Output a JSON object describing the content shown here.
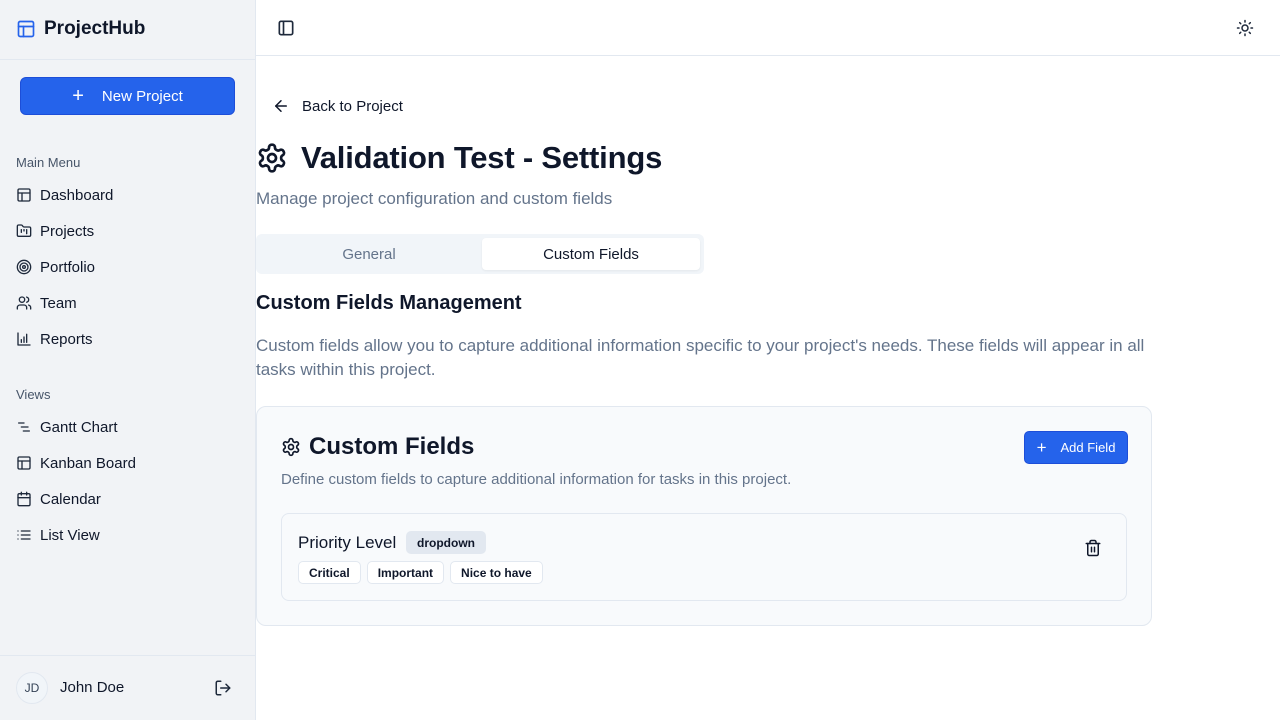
{
  "app": {
    "name": "ProjectHub"
  },
  "sidebar": {
    "new_project_label": "New Project",
    "main_menu_label": "Main Menu",
    "main_menu": [
      {
        "label": "Dashboard",
        "icon": "layout-icon"
      },
      {
        "label": "Projects",
        "icon": "folder-kanban-icon"
      },
      {
        "label": "Portfolio",
        "icon": "target-icon"
      },
      {
        "label": "Team",
        "icon": "users-icon"
      },
      {
        "label": "Reports",
        "icon": "bar-chart-icon"
      }
    ],
    "views_label": "Views",
    "views": [
      {
        "label": "Gantt Chart",
        "icon": "gantt-icon"
      },
      {
        "label": "Kanban Board",
        "icon": "kanban-icon"
      },
      {
        "label": "Calendar",
        "icon": "calendar-icon"
      },
      {
        "label": "List View",
        "icon": "list-icon"
      }
    ],
    "user": {
      "initials": "JD",
      "name": "John Doe"
    }
  },
  "page": {
    "back_label": "Back to Project",
    "title": "Validation Test - Settings",
    "subtitle": "Manage project configuration and custom fields",
    "tabs": [
      {
        "label": "General",
        "active": false
      },
      {
        "label": "Custom Fields",
        "active": true
      }
    ],
    "section_title": "Custom Fields Management",
    "section_desc": "Custom fields allow you to capture additional information specific to your project's needs. These fields will appear in all tasks within this project."
  },
  "card": {
    "title": "Custom Fields",
    "description": "Define custom fields to capture additional information for tasks in this project.",
    "add_label": "Add Field",
    "fields": [
      {
        "name": "Priority Level",
        "type": "dropdown",
        "options": [
          "Critical",
          "Important",
          "Nice to have"
        ]
      }
    ]
  },
  "colors": {
    "accent": "#2563eb",
    "sidebar_bg": "#f1f3f6",
    "muted_text": "#64748b"
  }
}
